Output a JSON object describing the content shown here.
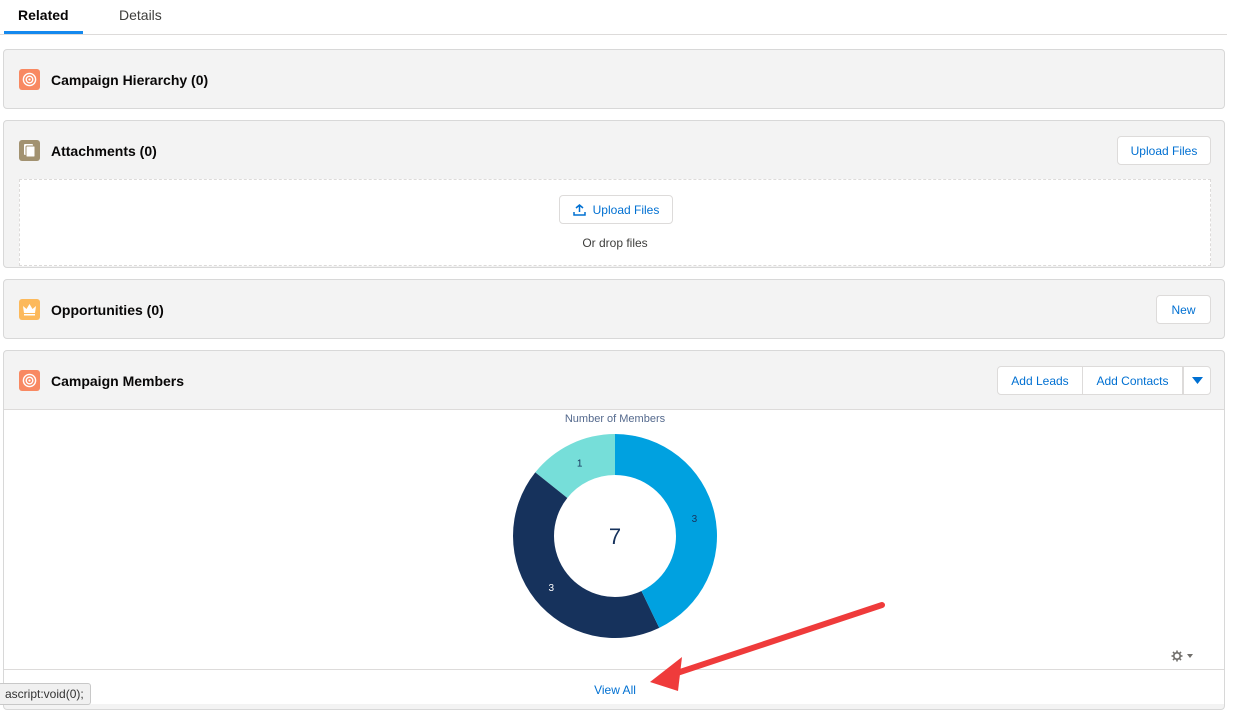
{
  "tabs": {
    "related": "Related",
    "details": "Details"
  },
  "cards": {
    "hierarchy": {
      "title": "Campaign Hierarchy (0)"
    },
    "attachments": {
      "title": "Attachments (0)",
      "upload_button": "Upload Files",
      "dropzone_button": "Upload Files",
      "drop_text": "Or drop files"
    },
    "opportunities": {
      "title": "Opportunities (0)",
      "new_button": "New"
    },
    "members": {
      "title": "Campaign Members",
      "add_leads": "Add Leads",
      "add_contacts": "Add Contacts",
      "view_all": "View All"
    }
  },
  "chart_data": {
    "type": "pie",
    "title": "Number of Members",
    "total": "7",
    "labels": [
      "3",
      "3",
      "1"
    ],
    "values": [
      3,
      3,
      1
    ],
    "colors": [
      "#00a1e0",
      "#16325c",
      "#76ded9"
    ]
  },
  "status_bar": {
    "url": "ascript:void(0);"
  },
  "icons": {
    "hierarchy": "target-icon",
    "attachments": "file-icon",
    "opportunities": "crown-icon",
    "members": "target-icon",
    "gear": "gear-icon",
    "dropdown": "chevron-down-icon",
    "upload": "upload-icon",
    "annotation": "red-arrow"
  },
  "colors": {
    "hierarchy_icon": "#f88962",
    "attachments_icon": "#a29271",
    "opportunities_icon": "#fcb95b",
    "members_icon": "#f88962",
    "link": "#0070d2",
    "arrow": "#ef3b3b"
  }
}
